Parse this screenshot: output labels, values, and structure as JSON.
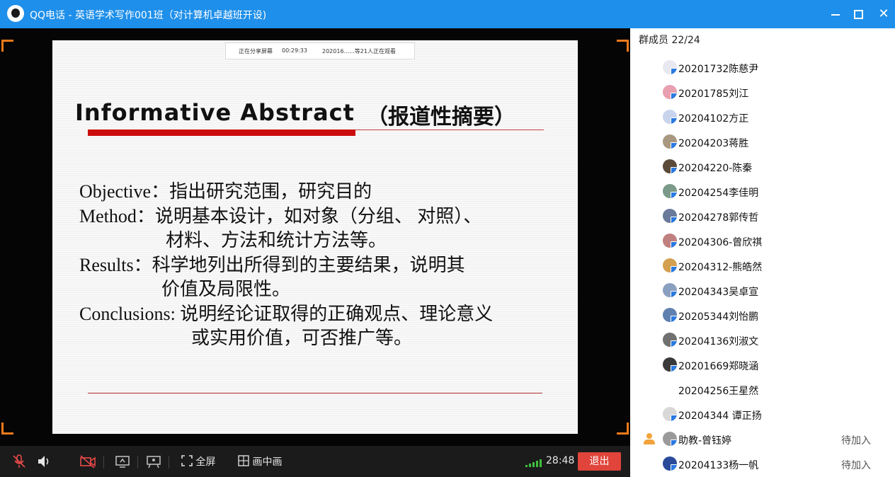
{
  "window": {
    "title": "QQ电话 - 英语学术写作001班（对计算机卓越班开设)",
    "close_glyph": "✕"
  },
  "share_bar": {
    "status": "正在分享屏幕",
    "time": "00:29:33",
    "viewers": "202016......等21人正在观看"
  },
  "slide": {
    "title": "Informative Abstract",
    "title_cn": "（报道性摘要）",
    "lines": [
      "Objective：指出研究范围，研究目的",
      "Method：说明基本设计，如对象（分组、 对照）、",
      "材料、方法和统计方法等。",
      "Results：科学地列出所得到的主要结果，说明其",
      "价值及局限性。",
      "Conclusions: 说明经论证取得的正确观点、理论意义",
      "或实用价值，可否推广等。"
    ]
  },
  "controls": {
    "fullscreen": "全屏",
    "pip": "画中画",
    "call_time": "28:48",
    "exit": "退出",
    "signal_bars": 5,
    "icons": [
      "mic-muted-icon",
      "speaker-icon",
      "camera-off-icon",
      "screen-share-icon",
      "whiteboard-icon",
      "fullscreen-icon",
      "pip-icon"
    ]
  },
  "sidebar": {
    "header": "群成员 22/24",
    "members": [
      {
        "name": "20201732陈慈尹",
        "status": "",
        "avatar_color": "#e8e8f0",
        "role": ""
      },
      {
        "name": "20201785刘江",
        "status": "",
        "avatar_color": "#e8a0b0",
        "role": ""
      },
      {
        "name": "20204102方正",
        "status": "",
        "avatar_color": "#c8d4ec",
        "role": ""
      },
      {
        "name": "20204203蒋胜",
        "status": "",
        "avatar_color": "#a89880",
        "role": ""
      },
      {
        "name": "20204220-陈秦",
        "status": "",
        "avatar_color": "#5a4a3a",
        "role": ""
      },
      {
        "name": "20204254李佳明",
        "status": "",
        "avatar_color": "#7a9a8a",
        "role": ""
      },
      {
        "name": "20204278郭传哲",
        "status": "",
        "avatar_color": "#6a7a9a",
        "role": ""
      },
      {
        "name": "20204306-曾欣祺",
        "status": "",
        "avatar_color": "#c08080",
        "role": ""
      },
      {
        "name": "20204312-熊皓然",
        "status": "",
        "avatar_color": "#d4a050",
        "role": ""
      },
      {
        "name": "20204343吴卓宣",
        "status": "",
        "avatar_color": "#8aa0c0",
        "role": ""
      },
      {
        "name": "20205344刘怡鹏",
        "status": "",
        "avatar_color": "#6080b0",
        "role": ""
      },
      {
        "name": "20204136刘淑文",
        "status": "",
        "avatar_color": "#707070",
        "role": ""
      },
      {
        "name": "20201669郑晓涵",
        "status": "",
        "avatar_color": "#3a3a3a",
        "role": ""
      },
      {
        "name": "20204256王星然",
        "status": "",
        "avatar_color": "",
        "role": ""
      },
      {
        "name": "20204344 谭正扬",
        "status": "",
        "avatar_color": "#d8d8d8",
        "role": ""
      },
      {
        "name": "助教-曾钰婷",
        "status": "待加入",
        "avatar_color": "#9a9a9a",
        "role": "assistant"
      },
      {
        "name": "20204133杨一帆",
        "status": "待加入",
        "avatar_color": "#2a4a9a",
        "role": ""
      }
    ]
  },
  "colors": {
    "titlebar": "#1e8fea",
    "exit_button": "#e0443a",
    "accent_corner": "#f07a1a",
    "slide_red": "#cc0d0d",
    "signal": "#3fbf3f"
  }
}
